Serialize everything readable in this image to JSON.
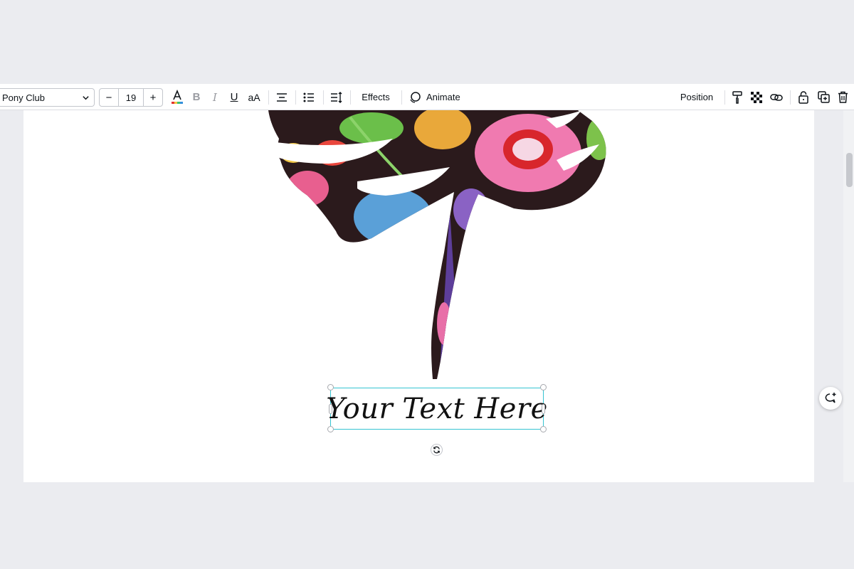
{
  "toolbar": {
    "font_family": "Pony Club",
    "font_size": "19",
    "decrease_label": "−",
    "increase_label": "+",
    "case_label": "aA",
    "effects_label": "Effects",
    "animate_label": "Animate",
    "position_label": "Position",
    "icons": [
      "text-color-icon",
      "bold-icon",
      "italic-icon",
      "underline-icon",
      "align-center-icon",
      "list-icon",
      "spacing-icon",
      "animate-icon",
      "paint-roller-icon",
      "transparency-icon",
      "link-icon",
      "lock-icon",
      "duplicate-icon",
      "trash-icon"
    ]
  },
  "canvas": {
    "text_element": "Your Text Here"
  },
  "colors": {
    "selection": "#35c4d2",
    "background": "#ebecf0",
    "page": "#ffffff"
  }
}
